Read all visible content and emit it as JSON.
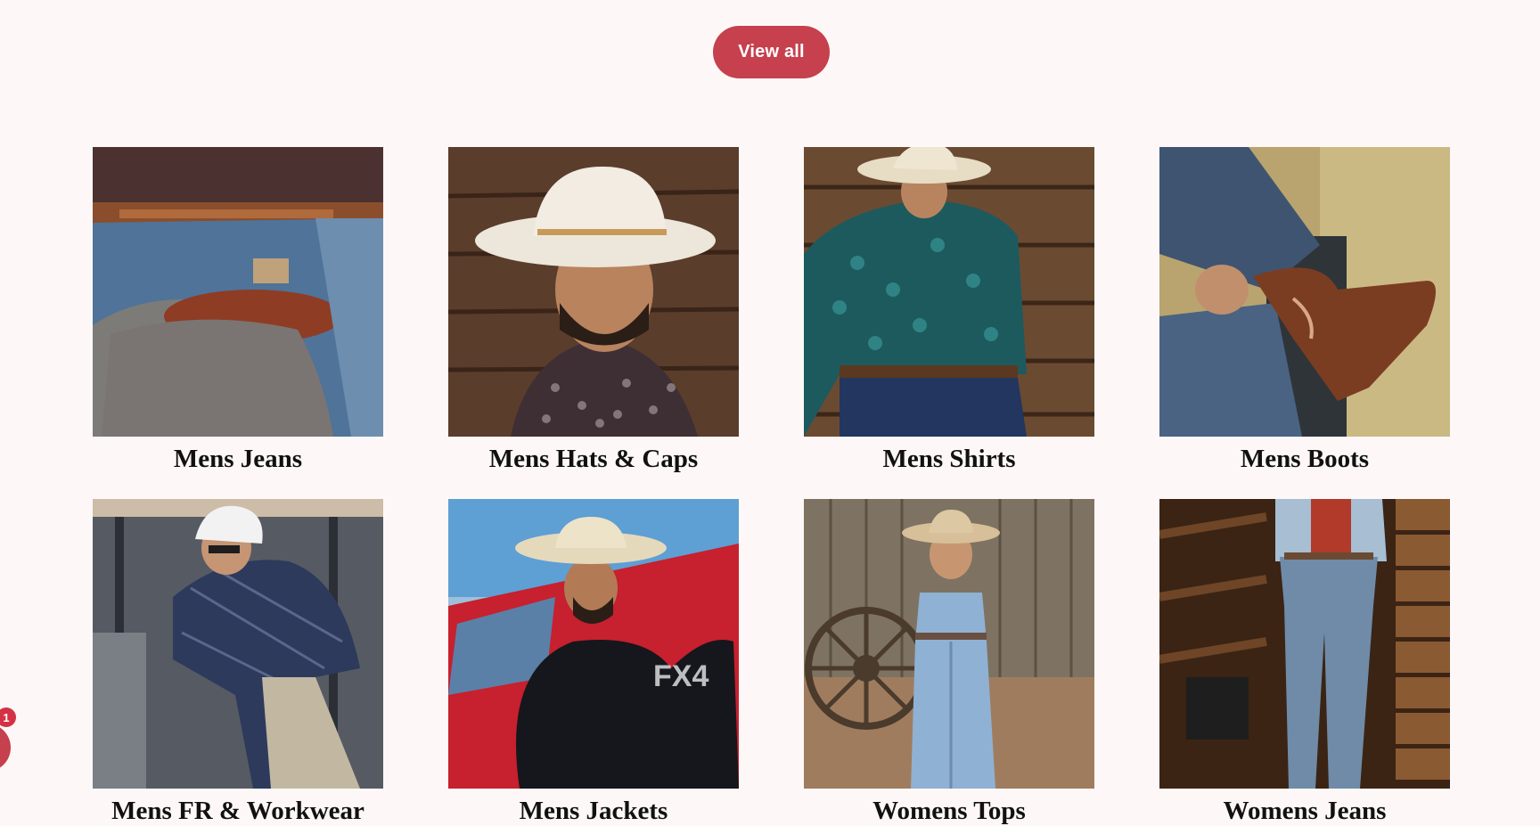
{
  "actions": {
    "view_all_label": "View all"
  },
  "collections": [
    {
      "title": "Mens Jeans"
    },
    {
      "title": "Mens Hats & Caps"
    },
    {
      "title": "Mens Shirts"
    },
    {
      "title": "Mens Boots"
    },
    {
      "title": "Mens FR & Workwear"
    },
    {
      "title": "Mens Jackets"
    },
    {
      "title": "Womens Tops"
    },
    {
      "title": "Womens Jeans"
    }
  ],
  "notifications": {
    "count": "1"
  },
  "colors": {
    "accent": "#c6404d",
    "background": "#fdf8f7"
  }
}
